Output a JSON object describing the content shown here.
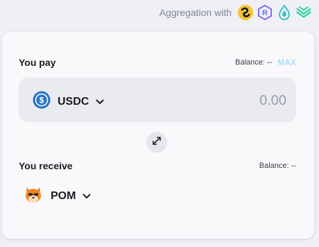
{
  "aggregation": {
    "label": "Aggregation with",
    "providers": [
      "raydium-like-1",
      "r-hex-logo",
      "drop-logo",
      "wave-logo"
    ]
  },
  "pay": {
    "title": "You pay",
    "balance": "Balance: --",
    "max_label": "MAX",
    "token": "USDC",
    "token_icon": "usdc-icon",
    "amount_placeholder": "0.00"
  },
  "swap_icon": "swap-arrows-icon",
  "receive": {
    "title": "You receive",
    "balance": "Balance: --",
    "token": "POM",
    "token_icon": "pom-icon"
  },
  "colors": {
    "accent_max": "#a8dff0",
    "usdc_blue": "#2775ca",
    "pom_orange": "#f08a24"
  }
}
